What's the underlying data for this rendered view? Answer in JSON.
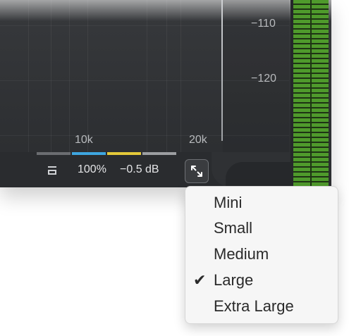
{
  "spectrum": {
    "db_labels": [
      "−110",
      "−120"
    ],
    "freq_labels": [
      "10k",
      "20k"
    ]
  },
  "status_bar": {
    "zoom": "100%",
    "gain": "−0.5 dB",
    "strip_colors": [
      "#6b6d71",
      "#3ea6e0",
      "#e4c93a",
      "#9c9ea1"
    ]
  },
  "icons": {
    "dock": "dock-icon",
    "resize": "resize-arrows-icon",
    "check": "checkmark-icon"
  },
  "size_menu": {
    "items": [
      {
        "label": "Mini",
        "checked": false
      },
      {
        "label": "Small",
        "checked": false
      },
      {
        "label": "Medium",
        "checked": false
      },
      {
        "label": "Large",
        "checked": true
      },
      {
        "label": "Extra Large",
        "checked": false
      }
    ],
    "check_glyph": "✔"
  },
  "meter": {
    "color": "#4f9a2c"
  }
}
